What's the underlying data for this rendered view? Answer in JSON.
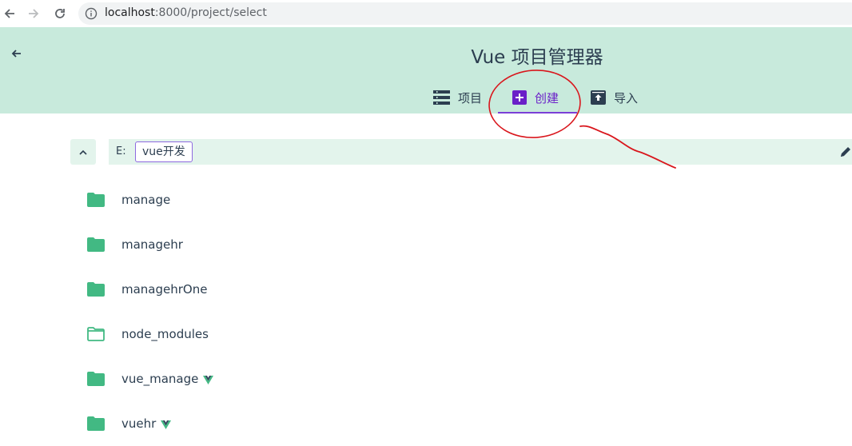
{
  "browser": {
    "url_host": "localhost",
    "url_path": ":8000/project/select"
  },
  "header": {
    "title": "Vue 项目管理器",
    "tabs": [
      {
        "label": "项目",
        "icon": "list-icon",
        "active": false
      },
      {
        "label": "创建",
        "icon": "add-box-icon",
        "active": true
      },
      {
        "label": "导入",
        "icon": "unarchive-icon",
        "active": false
      }
    ]
  },
  "path_bar": {
    "drive": "E:",
    "folder": "vue开发"
  },
  "folders": [
    {
      "name": "manage",
      "icon": "folder-icon",
      "filled": true,
      "vue": false
    },
    {
      "name": "managehr",
      "icon": "folder-icon",
      "filled": true,
      "vue": false
    },
    {
      "name": "managehrOne",
      "icon": "folder-icon",
      "filled": true,
      "vue": false
    },
    {
      "name": "node_modules",
      "icon": "folder-outline-icon",
      "filled": false,
      "vue": false
    },
    {
      "name": "vue_manage",
      "icon": "folder-icon",
      "filled": true,
      "vue": true
    },
    {
      "name": "vuehr",
      "icon": "folder-icon",
      "filled": true,
      "vue": true
    }
  ],
  "colors": {
    "header_bg": "#c8eadc",
    "accent_purple": "#6a1fc8",
    "folder_green": "#42b983",
    "annotation_red": "#d9161c"
  }
}
